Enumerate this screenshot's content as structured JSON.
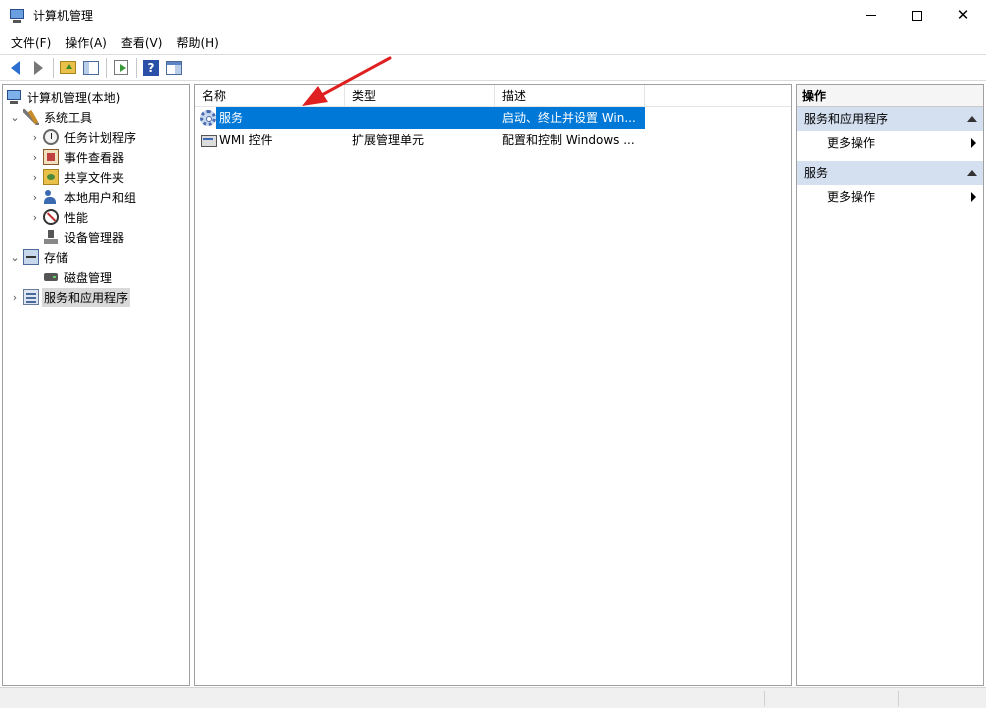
{
  "window": {
    "title": "计算机管理"
  },
  "menu": [
    "文件(F)",
    "操作(A)",
    "查看(V)",
    "帮助(H)"
  ],
  "toolbar": {
    "buttons": [
      "back-icon",
      "forward-icon",
      "up-folder-icon",
      "show-tree-icon",
      "export-list-icon",
      "help-icon",
      "action-pane-icon"
    ]
  },
  "tree": {
    "root": "计算机管理(本地)",
    "system_tools": "系统工具",
    "task_scheduler": "任务计划程序",
    "event_viewer": "事件查看器",
    "shared_folders": "共享文件夹",
    "local_users": "本地用户和组",
    "performance": "性能",
    "device_manager": "设备管理器",
    "storage": "存储",
    "disk_management": "磁盘管理",
    "services_apps": "服务和应用程序"
  },
  "list": {
    "columns": [
      "名称",
      "类型",
      "描述"
    ],
    "rows": [
      {
        "name": "服务",
        "type": "",
        "desc": "启动、终止并设置 Win...",
        "icon": "gear-icon",
        "selected": true
      },
      {
        "name": "WMI 控件",
        "type": "扩展管理单元",
        "desc": "配置和控制 Windows ...",
        "icon": "wmi-icon",
        "selected": false
      }
    ]
  },
  "actions": {
    "header": "操作",
    "groups": [
      {
        "title": "服务和应用程序",
        "item": "更多操作"
      },
      {
        "title": "服务",
        "item": "更多操作"
      }
    ]
  },
  "colors": {
    "selection": "#0078d7",
    "action_group_bg": "#d4dff0",
    "annotation_arrow": "#e02020"
  }
}
